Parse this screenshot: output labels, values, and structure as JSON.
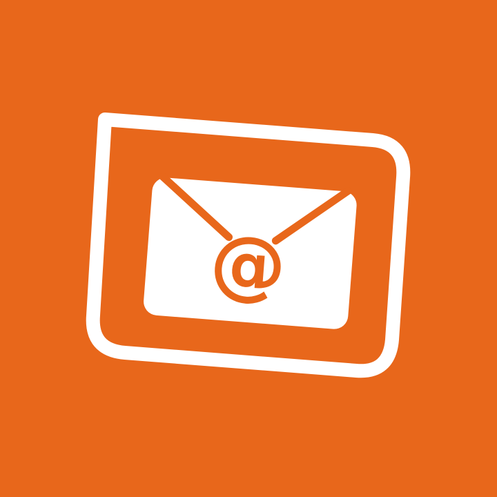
{
  "icon": {
    "name": "email-at-envelope-icon",
    "symbol": "@"
  },
  "colors": {
    "background": "#E8671B",
    "foreground": "#FFFFFF"
  }
}
